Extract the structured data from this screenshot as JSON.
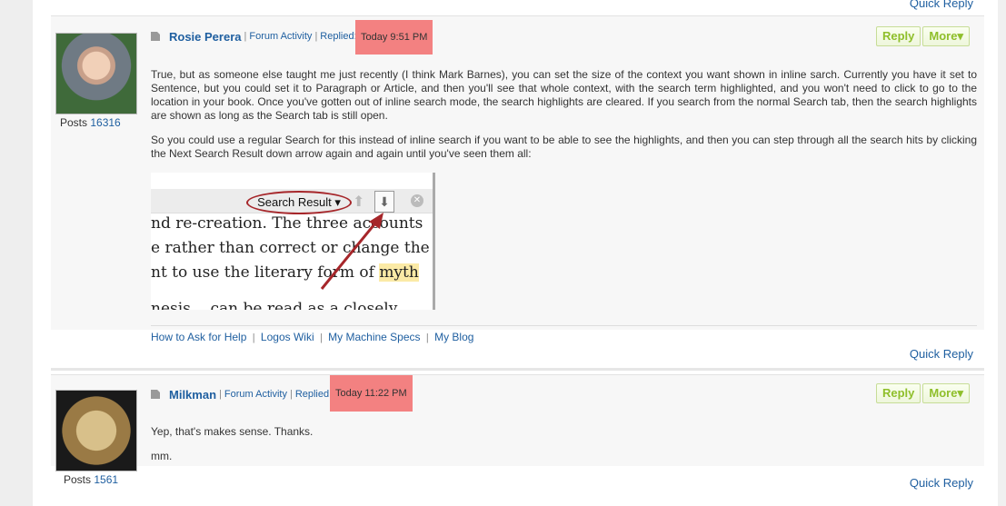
{
  "top": {
    "quick_reply": "Quick Reply"
  },
  "posts": [
    {
      "author": "Rosie Perera",
      "forum_activity": "Forum Activity",
      "replied_label": "Replied:",
      "replied_time": "Today 9:51 PM",
      "reply_button": "Reply",
      "more_button": "More▾",
      "posts_label": "Posts",
      "posts_count": "16316",
      "paragraphs": [
        "True, but as someone else taught me just recently (I think Mark Barnes), you can set the size of the context you want shown in inline sarch. Currently you have it set to Sentence, but you could set it to Paragraph or Article, and then you'll see that whole context, with the search term highlighted, and you won't need to click to go to the location in your book. Once you've gotten out of inline search mode, the search highlights are cleared. If you search from the normal Search tab, then the search highlights are shown as long as the Search tab is still open.",
        "So you could use a regular Search for this instead of inline search if you want to be able to see the highlights, and then you can step through all the search hits by clicking the Next Search Result down arrow again and again until you've seen them all:"
      ],
      "screenshot": {
        "search_result": "Search Result ▾",
        "line1": "nd re-creation. The three accounts",
        "line2": "e rather than correct or change the",
        "line3_a": "nt to use the literary form of ",
        "line3_b": "myth",
        "line4": "nesis .. can be read as a closely"
      },
      "signature": {
        "link1": "How to Ask for Help",
        "link2": "Logos Wiki",
        "link3": "My Machine Specs",
        "link4": "My Blog"
      },
      "quick_reply": "Quick Reply"
    },
    {
      "author": "Milkman",
      "forum_activity": "Forum Activity",
      "replied_label": "Replied:",
      "replied_time": "Today 11:22 PM",
      "reply_button": "Reply",
      "more_button": "More▾",
      "posts_label": "Posts",
      "posts_count": "1561",
      "paragraphs": [
        "Yep, that's makes sense. Thanks.",
        "mm."
      ],
      "quick_reply": "Quick Reply"
    }
  ],
  "colors": {
    "link": "#1f5fa0",
    "highlight": "#f38181",
    "button_text": "#8fbf2b",
    "arrow": "#a6262a"
  }
}
